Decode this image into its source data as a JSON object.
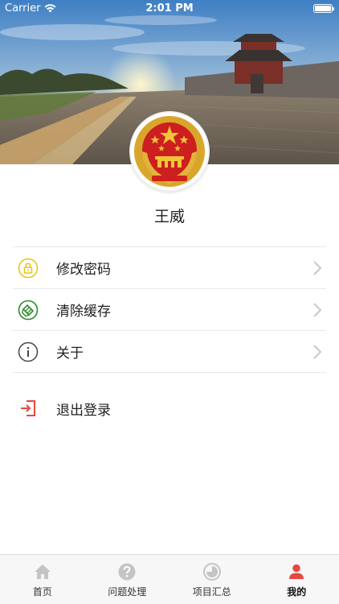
{
  "status_bar": {
    "carrier": "Carrier",
    "time": "2:01 PM"
  },
  "profile": {
    "name": "王威"
  },
  "menu": {
    "items": [
      {
        "label": "修改密码",
        "icon": "lock-icon"
      },
      {
        "label": "清除缓存",
        "icon": "clear-cache-icon"
      },
      {
        "label": "关于",
        "icon": "info-icon"
      }
    ],
    "logout_label": "退出登录"
  },
  "tabbar": {
    "tabs": [
      {
        "label": "首页",
        "icon": "home-icon",
        "active": false
      },
      {
        "label": "问题处理",
        "icon": "question-icon",
        "active": false
      },
      {
        "label": "项目汇总",
        "icon": "summary-icon",
        "active": false
      },
      {
        "label": "我的",
        "icon": "user-icon",
        "active": true
      }
    ]
  },
  "colors": {
    "accent": "#e8483f",
    "lock_icon": "#e8c417",
    "cache_icon": "#2f8a2f",
    "inactive_icon": "#c4c4c4"
  }
}
